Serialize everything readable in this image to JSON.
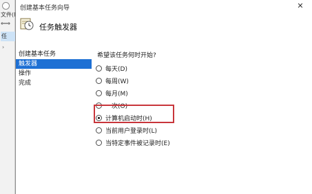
{
  "background_app": {
    "menu_label": "文件(F",
    "toolbar_glyphs": "⇐⇒",
    "tree_item": "任"
  },
  "dialog": {
    "title": "创建基本任务向导",
    "close_glyph": "✕",
    "header_title": "任务触发器"
  },
  "nav": {
    "items": [
      {
        "label": "创建基本任务",
        "active": false
      },
      {
        "label": "触发器",
        "active": true
      },
      {
        "label": "操作",
        "active": false
      },
      {
        "label": "完成",
        "active": false
      }
    ]
  },
  "question": "希望该任务何时开始?",
  "options": [
    {
      "label": "每天(D)",
      "checked": false
    },
    {
      "label": "每周(W)",
      "checked": false
    },
    {
      "label": "每月(M)",
      "checked": false
    },
    {
      "label": "一次(O)",
      "checked": false
    },
    {
      "label": "计算机启动时(H)",
      "checked": true
    },
    {
      "label": "当前用户登录时(L)",
      "checked": false
    },
    {
      "label": "当特定事件被记录时(E)",
      "checked": false
    }
  ],
  "colors": {
    "accent": "#1e70d4",
    "highlight_border": "#c8353a"
  }
}
